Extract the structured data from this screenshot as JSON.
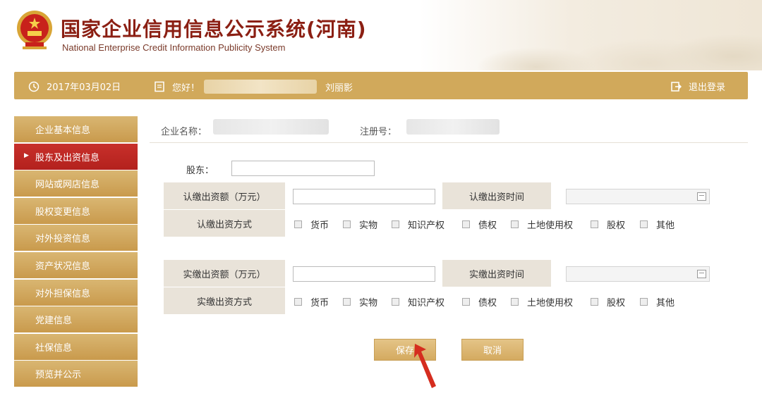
{
  "header": {
    "title_cn": "国家企业信用信息公示系统(河南)",
    "title_en": "National Enterprise Credit Information Publicity System"
  },
  "infobar": {
    "date": "2017年03月02日",
    "greeting": "您好！",
    "user_name": "刘丽影",
    "logout": "退出登录"
  },
  "sidebar": {
    "items": [
      {
        "label": "企业基本信息"
      },
      {
        "label": "股东及出资信息",
        "active": true
      },
      {
        "label": "网站或网店信息"
      },
      {
        "label": "股权变更信息"
      },
      {
        "label": "对外投资信息"
      },
      {
        "label": "资产状况信息"
      },
      {
        "label": "对外担保信息"
      },
      {
        "label": "党建信息"
      },
      {
        "label": "社保信息"
      },
      {
        "label": "预览并公示"
      }
    ]
  },
  "main": {
    "company_name_label": "企业名称：",
    "reg_no_label": "注册号：",
    "shareholder_label": "股东：",
    "subscribed": {
      "amount_label": "认缴出资额（万元）",
      "time_label": "认缴出资时间",
      "method_label": "认缴出资方式"
    },
    "paid": {
      "amount_label": "实缴出资额（万元）",
      "time_label": "实缴出资时间",
      "method_label": "实缴出资方式"
    },
    "methods": [
      "货币",
      "实物",
      "知识产权",
      "债权",
      "土地使用权",
      "股权",
      "其他"
    ],
    "save_button": "保存",
    "cancel_button": "取消"
  },
  "colors": {
    "gold": "#d1a95b",
    "active_red": "#b3211d",
    "title_red": "#8b1f13"
  }
}
